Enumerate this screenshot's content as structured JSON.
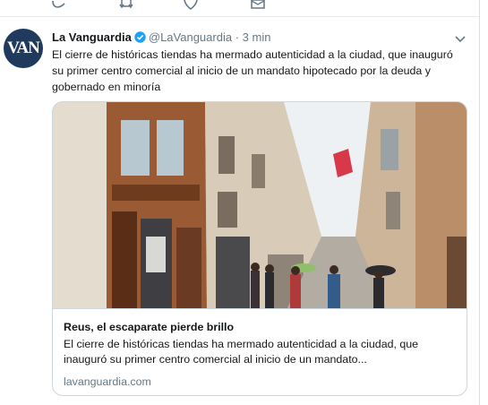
{
  "tweet": {
    "author_name": "La Vanguardia",
    "handle": "@LaVanguardia",
    "separator": "·",
    "time": "3 min",
    "avatar_text": "VAN",
    "text": "El cierre de históricas tiendas ha mermado autenticidad a la ciudad, que inauguró su primer centro comercial al inicio de un mandato hipotecado por la deuda y gobernado en minoría"
  },
  "card": {
    "title": "Reus, el escaparate pierde brillo",
    "description": "El cierre de históricas tiendas ha mermado autenticidad a la ciudad, que inauguró su primer centro comercial al inicio de un mandato...",
    "domain": "lavanguardia.com",
    "image_subject": "pedestrian shopping street with shuttered storefront"
  },
  "icons": [
    "reply-icon",
    "retweet-icon",
    "like-icon",
    "dm-icon",
    "verified-icon",
    "chevron-down-icon"
  ],
  "colors": {
    "text": "#14171a",
    "secondary": "#657786",
    "verified": "#1da1f2",
    "border": "#ccd6dd",
    "avatar_bg": "#1f3a5c"
  }
}
